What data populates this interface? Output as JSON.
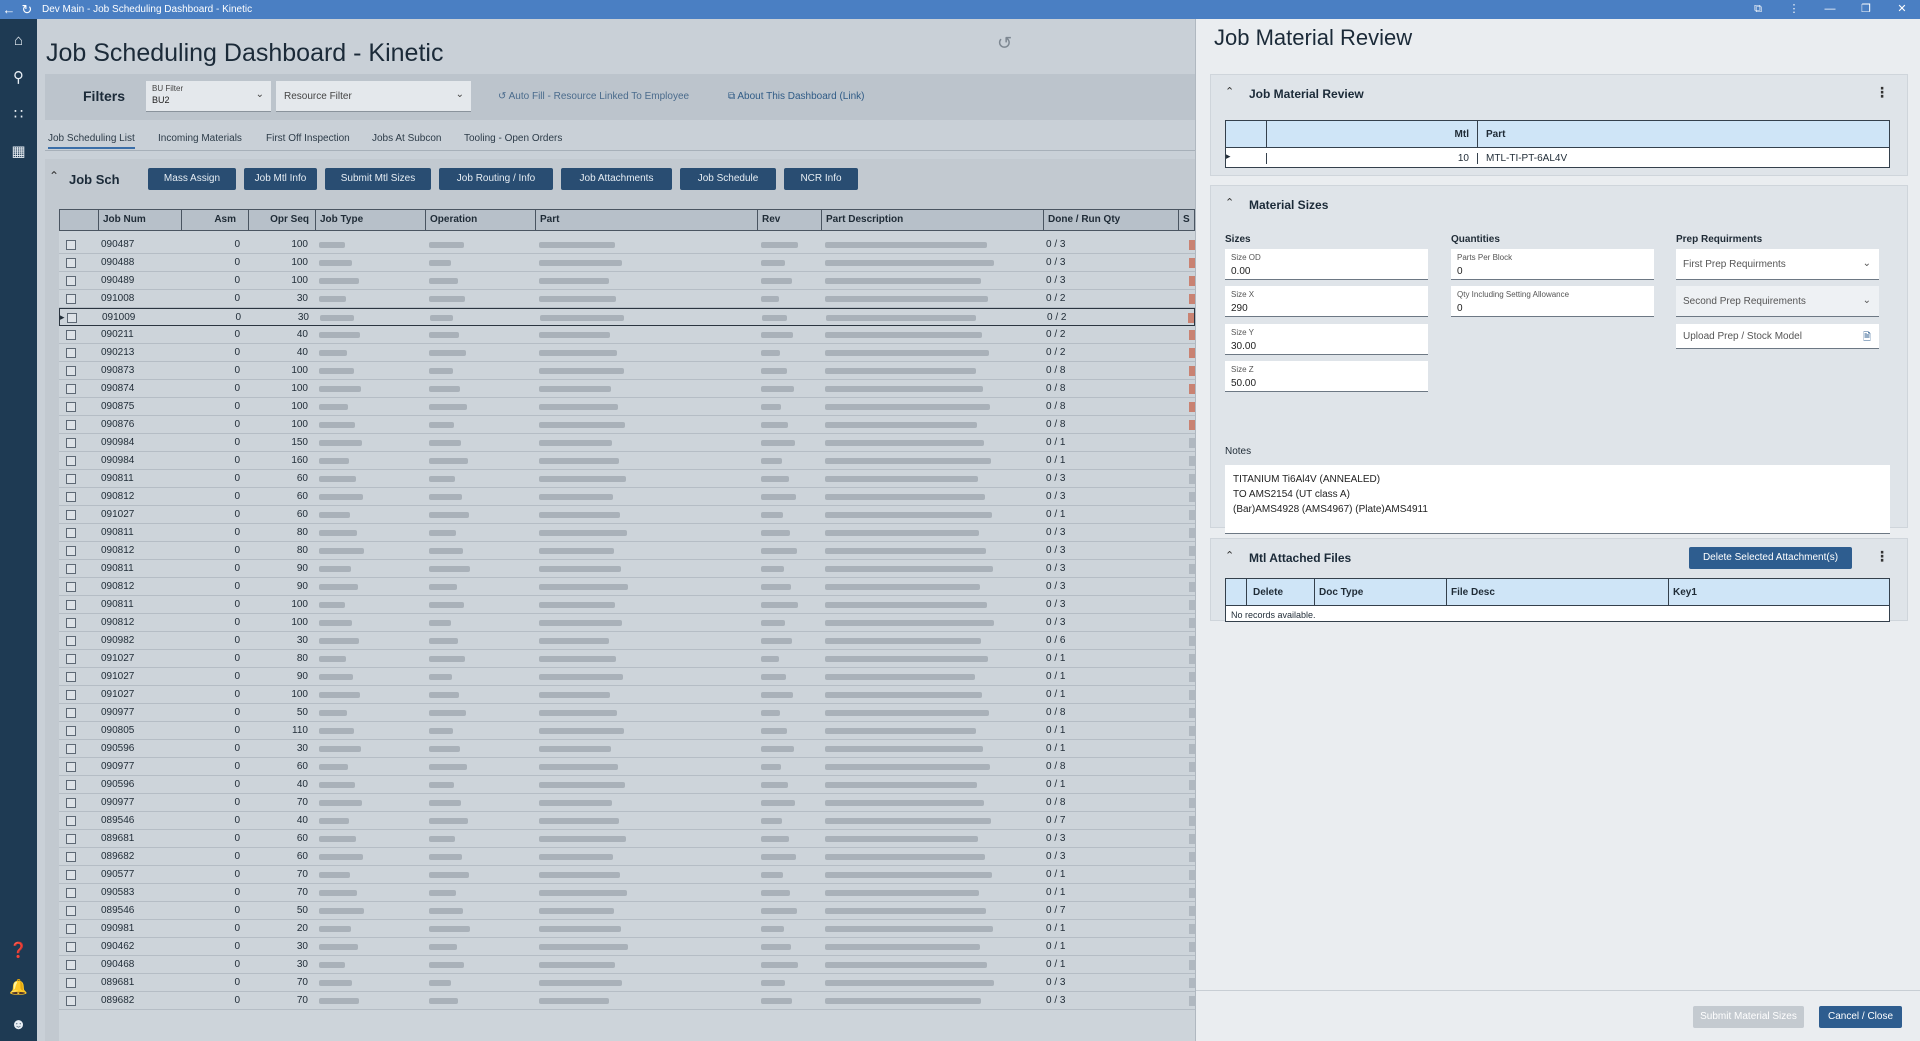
{
  "window": {
    "title": "Dev Main - Job Scheduling Dashboard - Kinetic",
    "title_icons": [
      "back-arrow-icon",
      "refresh-icon"
    ],
    "controls": [
      "share-icon",
      "more-icon",
      "minimize-icon",
      "restore-icon",
      "close-icon"
    ]
  },
  "sidebar": {
    "top_items": [
      "home-icon",
      "search-icon",
      "apps-grid-icon",
      "dashboard-icon"
    ],
    "bottom_items": [
      "help-icon",
      "notifications-icon",
      "user-icon"
    ]
  },
  "dashboard": {
    "title": "Job Scheduling Dashboard - Kinetic",
    "filters": {
      "label": "Filters",
      "bu_filter_caption": "BU Filter",
      "bu_filter_value": "BU2",
      "resource_filter_placeholder": "Resource Filter",
      "auto_fill_link": "Auto Fill - Resource Linked To Employee",
      "about_link": "About This Dashboard (Link)"
    },
    "tabs": [
      "Job Scheduling List",
      "Incoming Materials",
      "First Off Inspection",
      "Jobs At Subcon",
      "Tooling - Open Orders"
    ],
    "card": {
      "title": "Job Sch",
      "buttons": [
        "Mass Assign",
        "Job Mtl Info",
        "Submit Mtl Sizes",
        "Job Routing / Info",
        "Job Attachments",
        "Job Schedule",
        "NCR Info"
      ]
    },
    "grid": {
      "columns": [
        "Job Num",
        "Asm",
        "Opr Seq",
        "Job Type",
        "Operation",
        "Part",
        "Rev",
        "Part Description",
        "Done / Run Qty",
        "S"
      ],
      "rows": [
        [
          "090487",
          "0",
          "100",
          "0 / 3"
        ],
        [
          "090488",
          "0",
          "100",
          "0 / 3"
        ],
        [
          "090489",
          "0",
          "100",
          "0 / 3"
        ],
        [
          "091008",
          "0",
          "30",
          "0 / 2"
        ],
        [
          "091009",
          "0",
          "30",
          "0 / 2"
        ],
        [
          "090211",
          "0",
          "40",
          "0 / 2"
        ],
        [
          "090213",
          "0",
          "40",
          "0 / 2"
        ],
        [
          "090873",
          "0",
          "100",
          "0 / 8"
        ],
        [
          "090874",
          "0",
          "100",
          "0 / 8"
        ],
        [
          "090875",
          "0",
          "100",
          "0 / 8"
        ],
        [
          "090876",
          "0",
          "100",
          "0 / 8"
        ],
        [
          "090984",
          "0",
          "150",
          "0 / 1"
        ],
        [
          "090984",
          "0",
          "160",
          "0 / 1"
        ],
        [
          "090811",
          "0",
          "60",
          "0 / 3"
        ],
        [
          "090812",
          "0",
          "60",
          "0 / 3"
        ],
        [
          "091027",
          "0",
          "60",
          "0 / 1"
        ],
        [
          "090811",
          "0",
          "80",
          "0 / 3"
        ],
        [
          "090812",
          "0",
          "80",
          "0 / 3"
        ],
        [
          "090811",
          "0",
          "90",
          "0 / 3"
        ],
        [
          "090812",
          "0",
          "90",
          "0 / 3"
        ],
        [
          "090811",
          "0",
          "100",
          "0 / 3"
        ],
        [
          "090812",
          "0",
          "100",
          "0 / 3"
        ],
        [
          "090982",
          "0",
          "30",
          "0 / 6"
        ],
        [
          "091027",
          "0",
          "80",
          "0 / 1"
        ],
        [
          "091027",
          "0",
          "90",
          "0 / 1"
        ],
        [
          "091027",
          "0",
          "100",
          "0 / 1"
        ],
        [
          "090977",
          "0",
          "50",
          "0 / 8"
        ],
        [
          "090805",
          "0",
          "110",
          "0 / 1"
        ],
        [
          "090596",
          "0",
          "30",
          "0 / 1"
        ],
        [
          "090977",
          "0",
          "60",
          "0 / 8"
        ],
        [
          "090596",
          "0",
          "40",
          "0 / 1"
        ],
        [
          "090977",
          "0",
          "70",
          "0 / 8"
        ],
        [
          "089546",
          "0",
          "40",
          "0 / 7"
        ],
        [
          "089681",
          "0",
          "60",
          "0 / 3"
        ],
        [
          "089682",
          "0",
          "60",
          "0 / 3"
        ],
        [
          "090577",
          "0",
          "70",
          "0 / 1"
        ],
        [
          "090583",
          "0",
          "70",
          "0 / 1"
        ],
        [
          "089546",
          "0",
          "50",
          "0 / 7"
        ],
        [
          "090981",
          "0",
          "20",
          "0 / 1"
        ],
        [
          "090462",
          "0",
          "30",
          "0 / 1"
        ],
        [
          "090468",
          "0",
          "30",
          "0 / 1"
        ],
        [
          "089681",
          "0",
          "70",
          "0 / 3"
        ],
        [
          "089682",
          "0",
          "70",
          "0 / 3"
        ]
      ],
      "selected_row": 4
    }
  },
  "panel": {
    "title": "Job Material Review",
    "review_section": {
      "title": "Job Material Review",
      "columns": [
        "Mtl",
        "Part"
      ],
      "row": {
        "mtl": "10",
        "part": "MTL-TI-PT-6AL4V"
      }
    },
    "sizes_section": {
      "title": "Material Sizes",
      "sizes_caption": "Sizes",
      "quantities_caption": "Quantities",
      "prep_caption": "Prep Requirments",
      "size_od": {
        "label": "Size OD",
        "value": "0.00"
      },
      "size_x": {
        "label": "Size X",
        "value": "290"
      },
      "size_y": {
        "label": "Size Y",
        "value": "30.00"
      },
      "size_z": {
        "label": "Size Z",
        "value": "50.00"
      },
      "parts_per_block": {
        "label": "Parts Per Block",
        "value": "0"
      },
      "qty_incl": {
        "label": "Qty Including Setting Allowance",
        "value": "0"
      },
      "first_prep": "First Prep Requirments",
      "second_prep": "Second Prep Requirements",
      "upload_prep": "Upload Prep / Stock Model",
      "notes_caption": "Notes",
      "notes_lines": [
        "TITANIUM Ti6Al4V (ANNEALED)",
        "TO AMS2154 (UT class A)",
        "(Bar)AMS4928 (AMS4967) (Plate)AMS4911"
      ]
    },
    "files_section": {
      "title": "Mtl Attached Files",
      "delete_button": "Delete Selected Attachment(s)",
      "columns": [
        "Delete",
        "Doc Type",
        "File Desc",
        "Key1"
      ],
      "empty_text": "No records available."
    },
    "footer": {
      "submit": "Submit Material Sizes",
      "cancel": "Cancel / Close"
    }
  }
}
